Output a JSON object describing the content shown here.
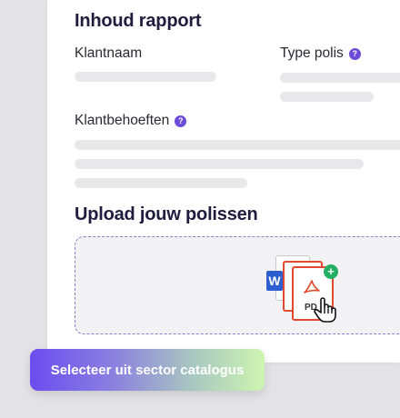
{
  "report": {
    "title": "Inhoud rapport",
    "customer_name_label": "Klantnaam",
    "policy_type_label": "Type polis",
    "customer_needs_label": "Klantbehoeften",
    "help_glyph": "?"
  },
  "upload": {
    "title": "Upload jouw polissen",
    "word_icon_letter": "W",
    "pdf_label": "PD",
    "plus_glyph": "+"
  },
  "cta": {
    "label": "Selecteer uit sector catalogus"
  },
  "colors": {
    "accent": "#6d4bd9",
    "pdf_red": "#e24a2f",
    "word_blue": "#2c5ecf",
    "add_green": "#23b065"
  },
  "icons": [
    "question-mark-icon",
    "word-document-icon",
    "pdf-document-icon",
    "add-icon",
    "hand-pointer-icon"
  ]
}
